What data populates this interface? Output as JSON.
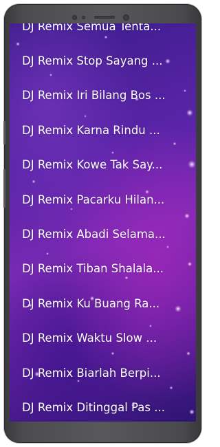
{
  "song_list": {
    "items": [
      {
        "label": "DJ Remix Semua Tenta..."
      },
      {
        "label": "DJ Remix Stop Sayang ..."
      },
      {
        "label": "DJ Remix Iri Bilang Bos ..."
      },
      {
        "label": "DJ Remix Karna Rindu ..."
      },
      {
        "label": "DJ Remix Kowe Tak Say..."
      },
      {
        "label": "DJ Remix Pacarku Hilan..."
      },
      {
        "label": "DJ Remix Abadi Selama..."
      },
      {
        "label": "DJ Remix Tiban Shalala..."
      },
      {
        "label": "DJ Remix Ku Buang Ra..."
      },
      {
        "label": "DJ Remix Waktu Slow ..."
      },
      {
        "label": "DJ Remix Biarlah Berpi..."
      },
      {
        "label": "DJ Remix Ditinggal Pas ..."
      }
    ]
  },
  "colors": {
    "background_top": "#3a1c8a",
    "background_mid": "#7a2ab4",
    "text": "#ffffff",
    "device_frame": "#4c4c4f"
  }
}
